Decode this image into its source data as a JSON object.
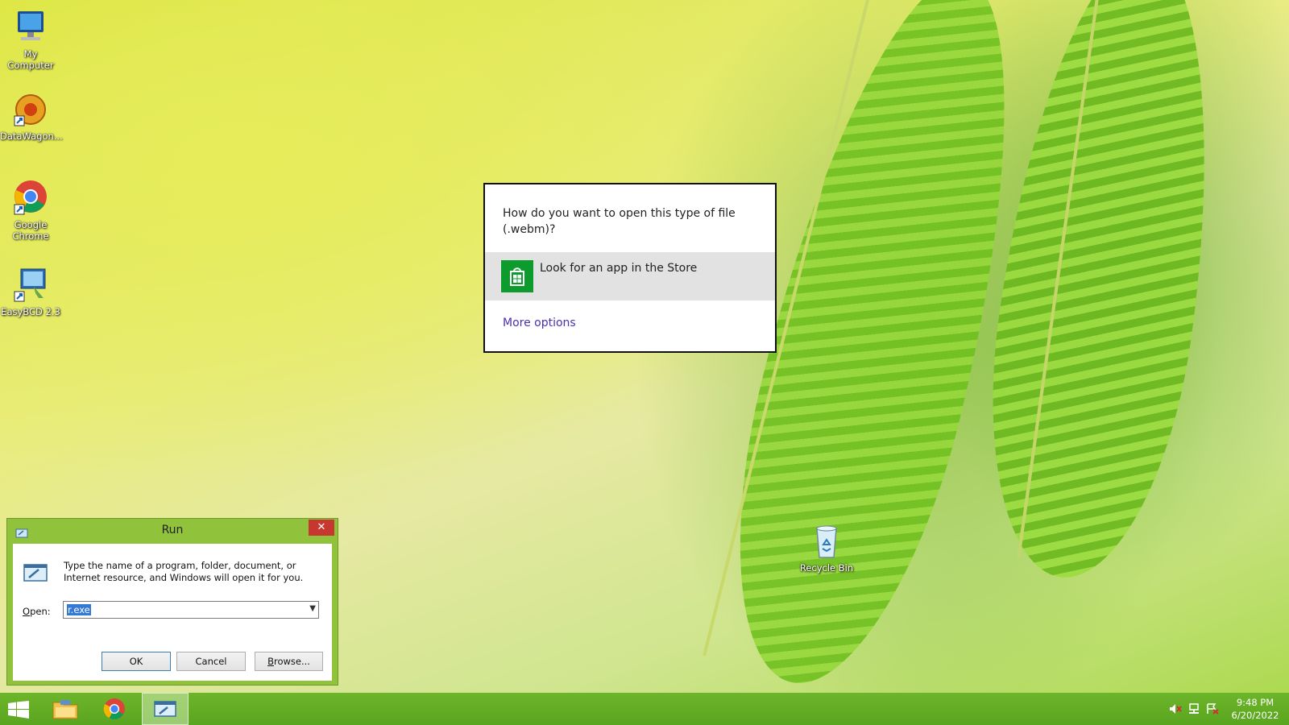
{
  "desktop": {
    "icons": [
      {
        "label": "My Computer",
        "icon": "computer-icon"
      },
      {
        "label": "DataWagon...",
        "icon": "datawagon-icon"
      },
      {
        "label": "Google Chrome",
        "icon": "chrome-icon"
      },
      {
        "label": "EasyBCD 2.3",
        "icon": "easybcd-icon"
      },
      {
        "label": "Recycle Bin",
        "icon": "recycle-bin-icon"
      }
    ]
  },
  "open_with": {
    "question": "How do you want to open this type of file (.webm)?",
    "store_option": "Look for an app in the Store",
    "more_options": "More options",
    "store_color": "#0c9b2c",
    "link_color": "#4b2fae"
  },
  "run_dialog": {
    "title": "Run",
    "close_glyph": "✕",
    "description": "Type the name of a program, folder, document, or Internet resource, and Windows will open it for you.",
    "open_label_accel": "O",
    "open_label_rest": "pen:",
    "open_value": "r.exe",
    "ok_label": "OK",
    "cancel_label": "Cancel",
    "browse_accel": "B",
    "browse_rest": "rowse..."
  },
  "taskbar": {
    "buttons": [
      "start-icon",
      "file-explorer-icon",
      "chrome-icon",
      "run-icon"
    ],
    "active_button": "run-icon",
    "tray": [
      "volume-muted-icon",
      "network-icon",
      "action-center-icon"
    ],
    "time": "9:48 PM",
    "date": "6/20/2022"
  }
}
